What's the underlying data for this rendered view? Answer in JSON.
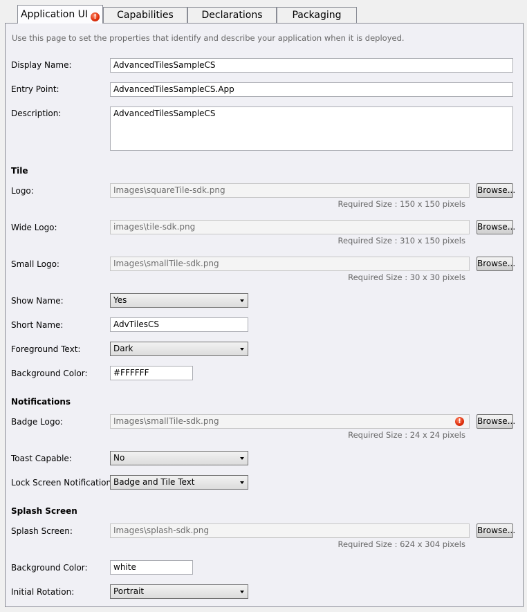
{
  "tabs": [
    {
      "label": "Application UI",
      "active": true,
      "has_error": true
    },
    {
      "label": "Capabilities"
    },
    {
      "label": "Declarations"
    },
    {
      "label": "Packaging"
    }
  ],
  "intro": "Use this page to set the properties that identify and describe your application when it is deployed.",
  "app": {
    "display_name_label": "Display Name:",
    "display_name": "AdvancedTilesSampleCS",
    "entry_point_label": "Entry Point:",
    "entry_point": "AdvancedTilesSampleCS.App",
    "description_label": "Description:",
    "description": "AdvancedTilesSampleCS"
  },
  "tile": {
    "section": "Tile",
    "logo_label": "Logo:",
    "logo": "Images\\squareTile-sdk.png",
    "logo_req": "Required Size : 150 x 150 pixels",
    "wide_logo_label": "Wide Logo:",
    "wide_logo": "images\\tile-sdk.png",
    "wide_logo_req": "Required Size : 310 x 150 pixels",
    "small_logo_label": "Small Logo:",
    "small_logo": "Images\\smallTile-sdk.png",
    "small_logo_req": "Required Size : 30 x 30 pixels",
    "show_name_label": "Show Name:",
    "show_name": "Yes",
    "short_name_label": "Short Name:",
    "short_name": "AdvTilesCS",
    "foreground_text_label": "Foreground Text:",
    "foreground_text": "Dark",
    "background_color_label": "Background Color:",
    "background_color": "#FFFFFF"
  },
  "notifications": {
    "section": "Notifications",
    "badge_logo_label": "Badge Logo:",
    "badge_logo": "Images\\smallTile-sdk.png",
    "badge_logo_req": "Required Size : 24 x 24 pixels",
    "toast_capable_label": "Toast Capable:",
    "toast_capable": "No",
    "lock_screen_label": "Lock Screen Notifications:",
    "lock_screen": "Badge and Tile Text"
  },
  "splash": {
    "section": "Splash Screen",
    "splash_label": "Splash Screen:",
    "splash": "Images\\splash-sdk.png",
    "splash_req": "Required Size : 624 x 304 pixels",
    "background_color_label": "Background Color:",
    "background_color": "white",
    "rotation_label": "Initial Rotation:",
    "rotation": "Portrait"
  },
  "browse_label": "Browse...",
  "error_glyph": "!",
  "icons": {
    "error": "error-icon",
    "dropdown": "chevron-down-icon"
  },
  "colors": {
    "error": "#e0320f",
    "border": "#898c95"
  }
}
